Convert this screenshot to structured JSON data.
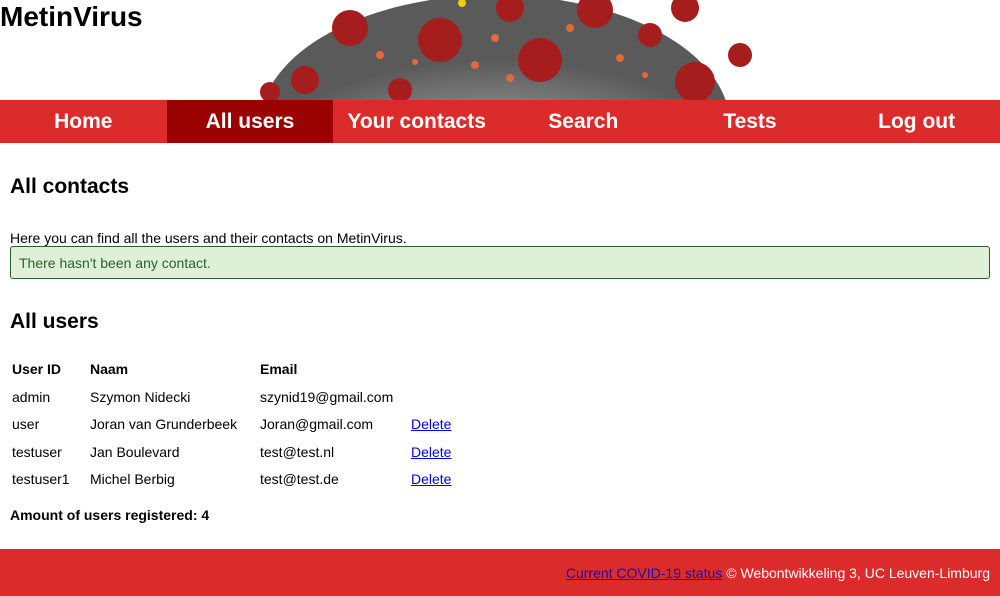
{
  "site": {
    "title": "MetinVirus"
  },
  "nav": {
    "items": [
      {
        "label": "Home"
      },
      {
        "label": "All users",
        "active": true
      },
      {
        "label": "Your contacts"
      },
      {
        "label": "Search"
      },
      {
        "label": "Tests"
      },
      {
        "label": "Log out"
      }
    ]
  },
  "contacts": {
    "heading": "All contacts",
    "intro": "Here you can find all the users and their contacts on MetinVirus.",
    "alert": "There hasn't been any contact."
  },
  "users": {
    "heading": "All users",
    "columns": [
      "User ID",
      "Naam",
      "Email"
    ],
    "rows": [
      {
        "id": "admin",
        "naam": "Szymon Nidecki",
        "email": "szynid19@gmail.com",
        "action": ""
      },
      {
        "id": "user",
        "naam": "Joran van Grunderbeek",
        "email": "Joran@gmail.com",
        "action": "Delete"
      },
      {
        "id": "testuser",
        "naam": "Jan Boulevard",
        "email": "test@test.nl",
        "action": "Delete"
      },
      {
        "id": "testuser1",
        "naam": "Michel Berbig",
        "email": "test@test.de",
        "action": "Delete"
      }
    ],
    "count_label": "Amount of users registered: 4"
  },
  "footer": {
    "link": "Current COVID-19 status",
    "text": "© Webontwikkeling 3, UC Leuven-Limburg"
  },
  "colors": {
    "nav_bg": "#dc2b2b",
    "nav_active": "#9b0202",
    "alert_bg": "#dff0d8"
  }
}
